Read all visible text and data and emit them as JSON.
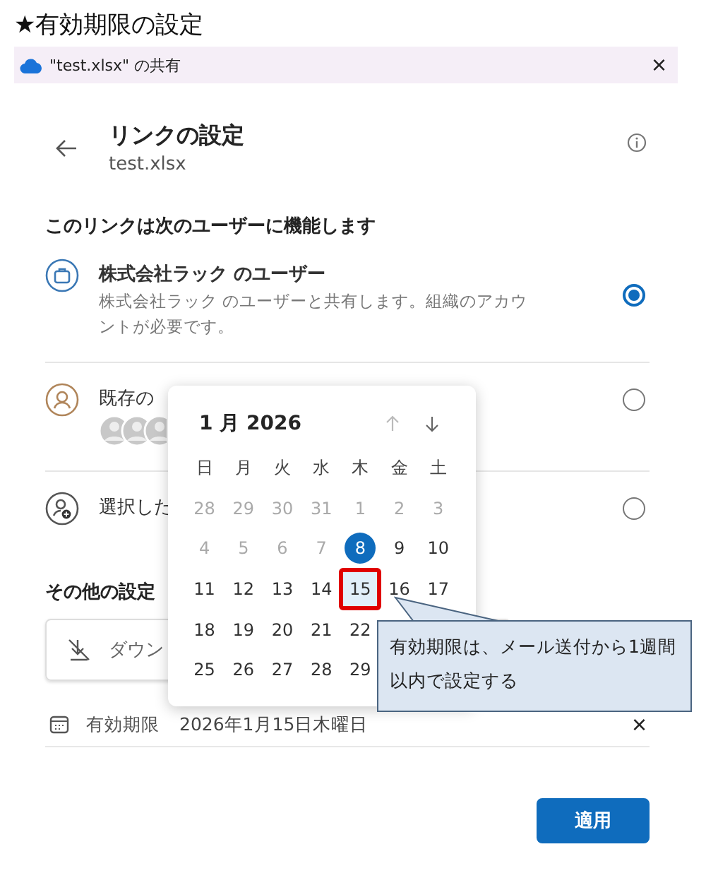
{
  "page_title": "★有効期限の設定",
  "dialog": {
    "title": "\"test.xlsx\" の共有",
    "close": "×"
  },
  "header": {
    "title": "リンクの設定",
    "subtitle": "test.xlsx"
  },
  "section_heading": "このリンクは次のユーザーに機能します",
  "options": [
    {
      "kind": "org",
      "title": "株式会社ラック のユーザー",
      "description": "株式会社ラック のユーザーと共有します。組織のアカウントが必要です。",
      "selected": true
    },
    {
      "kind": "existing",
      "title": "既存の",
      "selected": false
    },
    {
      "kind": "specific",
      "title": "選択した",
      "selected": false
    }
  ],
  "other_heading": "その他の設定",
  "download_field": {
    "text": "ダウン"
  },
  "expiry": {
    "label": "有効期限",
    "value": "2026年1月15日木曜日",
    "clear": "×"
  },
  "apply_button": "適用",
  "calendar": {
    "month": "1 月 2026",
    "weekdays": [
      "日",
      "月",
      "火",
      "水",
      "木",
      "金",
      "土"
    ],
    "weeks": [
      [
        {
          "day": "28",
          "muted": true
        },
        {
          "day": "29",
          "muted": true
        },
        {
          "day": "30",
          "muted": true
        },
        {
          "day": "31",
          "muted": true
        },
        {
          "day": "1",
          "muted": true
        },
        {
          "day": "2",
          "muted": true
        },
        {
          "day": "3",
          "muted": true
        }
      ],
      [
        {
          "day": "4",
          "muted": true
        },
        {
          "day": "5",
          "muted": true
        },
        {
          "day": "6",
          "muted": true
        },
        {
          "day": "7",
          "muted": true
        },
        {
          "day": "8",
          "today": true
        },
        {
          "day": "9"
        },
        {
          "day": "10"
        }
      ],
      [
        {
          "day": "11"
        },
        {
          "day": "12"
        },
        {
          "day": "13"
        },
        {
          "day": "14"
        },
        {
          "day": "15",
          "selected": true,
          "highlighted": true
        },
        {
          "day": "16"
        },
        {
          "day": "17"
        }
      ],
      [
        {
          "day": "18"
        },
        {
          "day": "19"
        },
        {
          "day": "20"
        },
        {
          "day": "21"
        },
        {
          "day": "22"
        }
      ],
      [
        {
          "day": "25"
        },
        {
          "day": "26"
        },
        {
          "day": "27"
        },
        {
          "day": "28"
        },
        {
          "day": "29"
        }
      ]
    ]
  },
  "callout": {
    "text": "有効期限は、メール送付から1週間以内で設定する"
  }
}
